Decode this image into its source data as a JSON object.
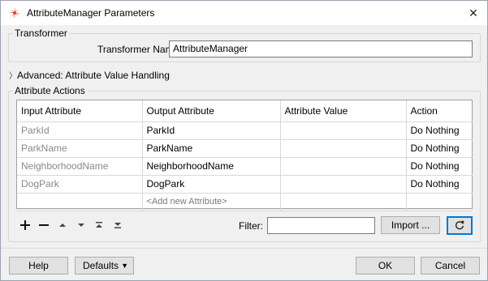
{
  "window": {
    "title": "AttributeManager Parameters",
    "close_symbol": "✕"
  },
  "transformer": {
    "group_label": "Transformer",
    "name_label": "Transformer Name:",
    "name_value": "AttributeManager"
  },
  "advanced": {
    "label": "Advanced: Attribute Value Handling"
  },
  "attribute_actions": {
    "group_label": "Attribute Actions",
    "columns": [
      "Input Attribute",
      "Output Attribute",
      "Attribute Value",
      "Action"
    ],
    "rows": [
      {
        "input": "ParkId",
        "output": "ParkId",
        "value": "",
        "action": "Do Nothing"
      },
      {
        "input": "ParkName",
        "output": "ParkName",
        "value": "",
        "action": "Do Nothing"
      },
      {
        "input": "NeighborhoodName",
        "output": "NeighborhoodName",
        "value": "",
        "action": "Do Nothing"
      },
      {
        "input": "DogPark",
        "output": "DogPark",
        "value": "",
        "action": "Do Nothing"
      }
    ],
    "add_placeholder": "<Add new Attribute>"
  },
  "toolbar": {
    "add_icon": "plus-icon",
    "remove_icon": "minus-icon",
    "move_up_icon": "triangle-up-icon",
    "move_down_icon": "triangle-down-icon",
    "move_top_icon": "move-to-top-icon",
    "move_bottom_icon": "move-to-bottom-icon",
    "filter_label": "Filter:",
    "filter_value": "",
    "import_label": "Import ...",
    "refresh_icon": "refresh-icon"
  },
  "footer": {
    "help_label": "Help",
    "defaults_label": "Defaults",
    "ok_label": "OK",
    "cancel_label": "Cancel"
  },
  "colors": {
    "accent": "#0078d7",
    "window_bg": "#f0f0f0",
    "grey_text": "#8a8a8a"
  }
}
